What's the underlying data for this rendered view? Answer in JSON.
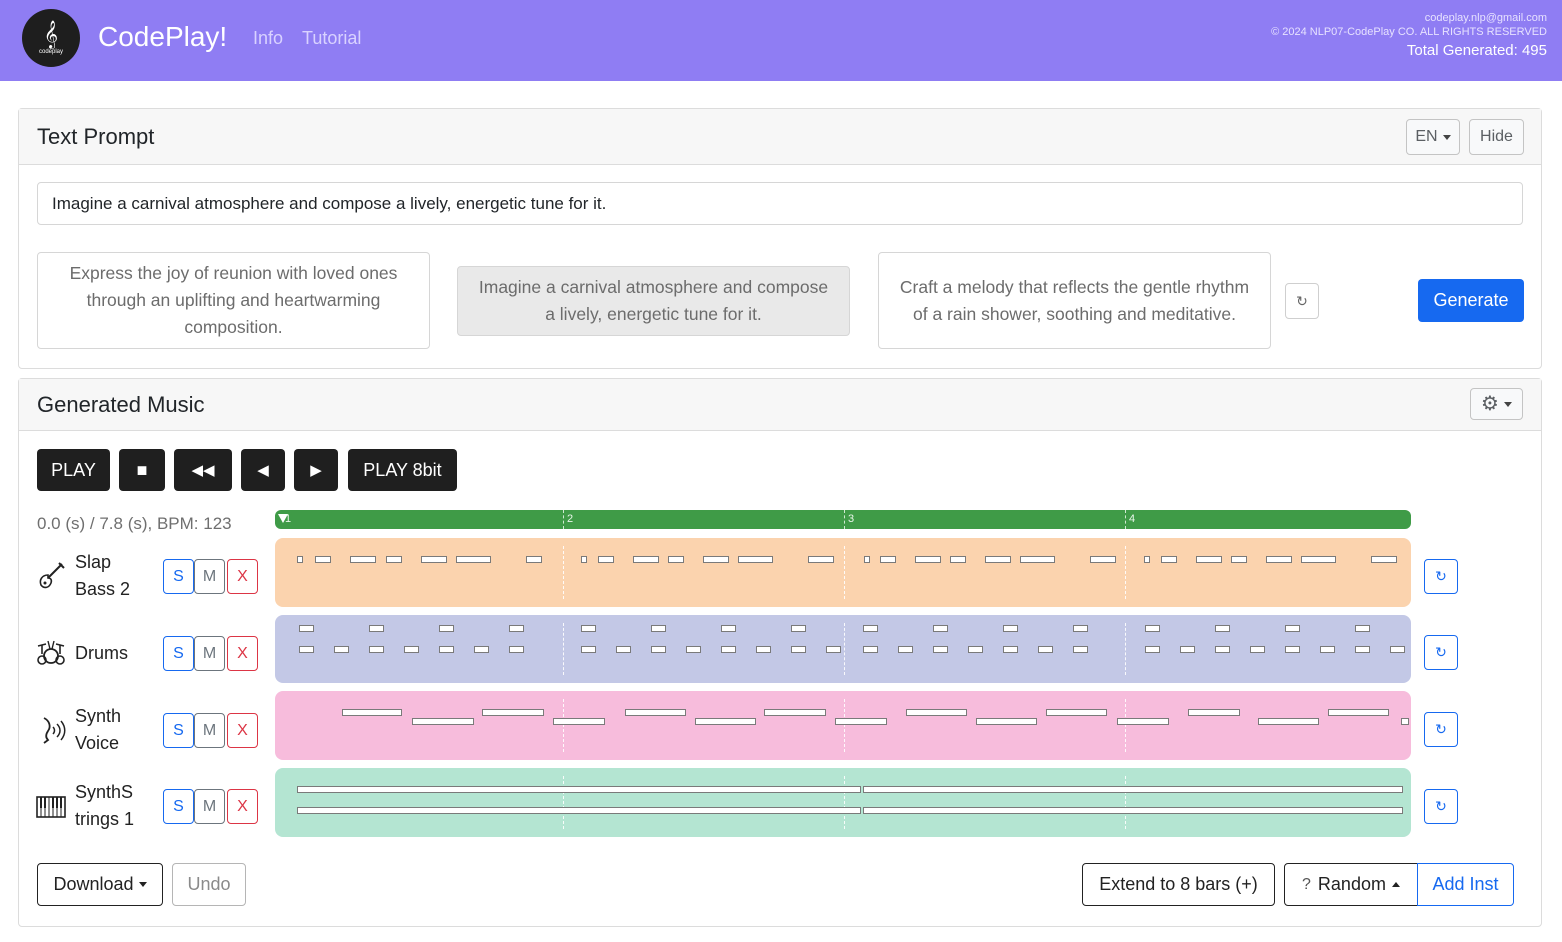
{
  "header": {
    "logo_text": "codeplay",
    "brand": "CodePlay!",
    "nav": [
      "Info",
      "Tutorial"
    ],
    "email": "codeplay.nlp@gmail.com",
    "copyright": "© 2024 NLP07-CodePlay CO. ALL RIGHTS RESERVED",
    "total_generated": "Total Generated: 495"
  },
  "prompt_card": {
    "title": "Text Prompt",
    "lang": "EN",
    "hide": "Hide",
    "input_value": "Imagine a carnival atmosphere and compose a lively, energetic tune for it.",
    "suggestions": [
      "Express the joy of reunion with loved ones through an uplifting and heartwarming composition.",
      "Imagine a carnival atmosphere and compose a lively, energetic tune for it.",
      "Craft a melody that reflects the gentle rhythm of a rain shower, soothing and meditative."
    ],
    "generate": "Generate"
  },
  "music_card": {
    "title": "Generated Music",
    "transport": {
      "play": "PLAY",
      "stop": "■",
      "rewind": "◀◀",
      "back": "◀",
      "forward": "▶",
      "play8bit": "PLAY 8bit"
    },
    "time_status": "0.0 (s) / 7.8 (s), BPM: 123",
    "bars": [
      "1",
      "2",
      "3",
      "4"
    ],
    "tracks": [
      {
        "name": "Slap Bass 2",
        "icon": "bass-guitar-icon",
        "color": "#fbd3ae"
      },
      {
        "name": "Drums",
        "icon": "drum-kit-icon",
        "color": "#c3c8e6"
      },
      {
        "name": "Synth Voice",
        "icon": "synth-voice-icon",
        "color": "#f7bcdc"
      },
      {
        "name": "SynthS trings 1",
        "icon": "keyboard-icon",
        "color": "#b4e5d2"
      }
    ],
    "solo": "S",
    "mute": "M",
    "remove": "X"
  },
  "bottom": {
    "download": "Download",
    "undo": "Undo",
    "extend": "Extend to 8 bars (+)",
    "random": "Random",
    "random_icon": "?",
    "add_inst": "Add Inst"
  }
}
